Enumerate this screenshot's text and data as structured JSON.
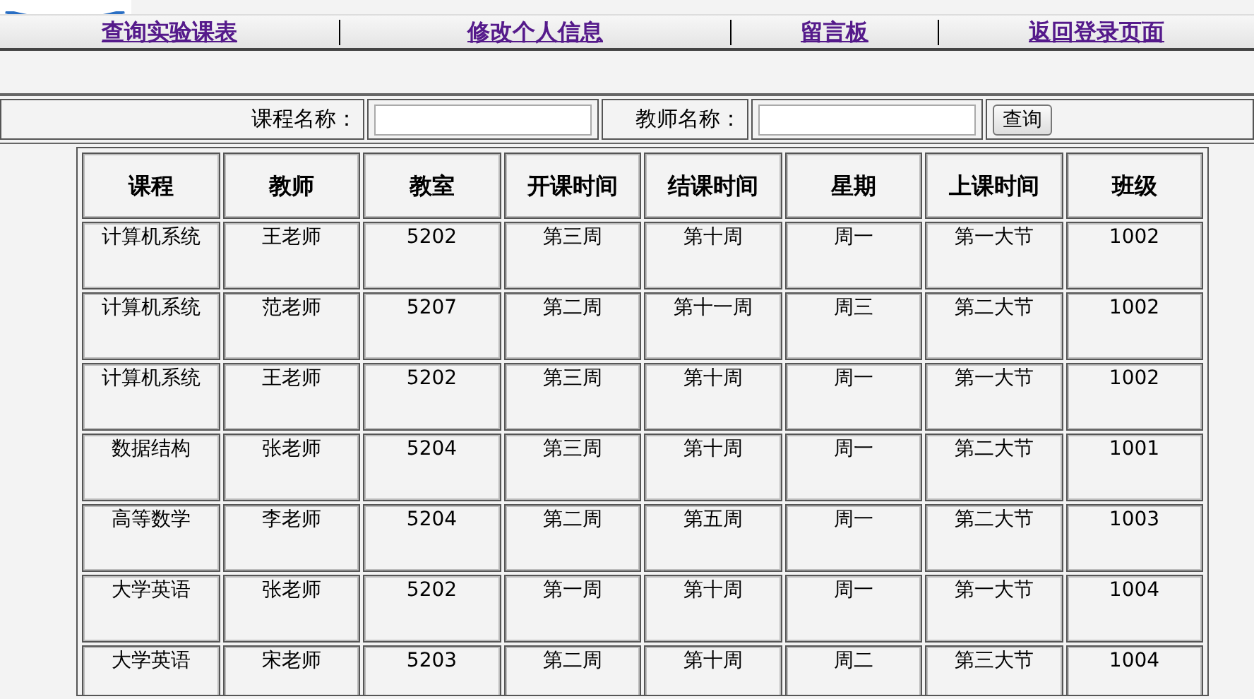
{
  "nav": [
    {
      "label": "查询实验课表"
    },
    {
      "label": "修改个人信息"
    },
    {
      "label": "留言板"
    },
    {
      "label": "返回登录页面"
    }
  ],
  "search": {
    "fields": [
      {
        "label": "课程名称："
      },
      {
        "label": "教师名称："
      }
    ],
    "button": "查询"
  },
  "table": {
    "columns": [
      "课程",
      "教师",
      "教室",
      "开课时间",
      "结课时间",
      "星期",
      "上课时间",
      "班级"
    ],
    "rows": [
      [
        "计算机系统",
        "王老师",
        "5202",
        "第三周",
        "第十周",
        "周一",
        "第一大节",
        "1002"
      ],
      [
        "计算机系统",
        "范老师",
        "5207",
        "第二周",
        "第十一周",
        "周三",
        "第二大节",
        "1002"
      ],
      [
        "计算机系统",
        "王老师",
        "5202",
        "第三周",
        "第十周",
        "周一",
        "第一大节",
        "1002"
      ],
      [
        "数据结构",
        "张老师",
        "5204",
        "第三周",
        "第十周",
        "周一",
        "第二大节",
        "1001"
      ],
      [
        "高等数学",
        "李老师",
        "5204",
        "第二周",
        "第五周",
        "周一",
        "第二大节",
        "1003"
      ],
      [
        "大学英语",
        "张老师",
        "5202",
        "第一周",
        "第十周",
        "周一",
        "第一大节",
        "1004"
      ],
      [
        "大学英语",
        "宋老师",
        "5203",
        "第二周",
        "第十周",
        "周二",
        "第三大节",
        "1004"
      ]
    ]
  }
}
